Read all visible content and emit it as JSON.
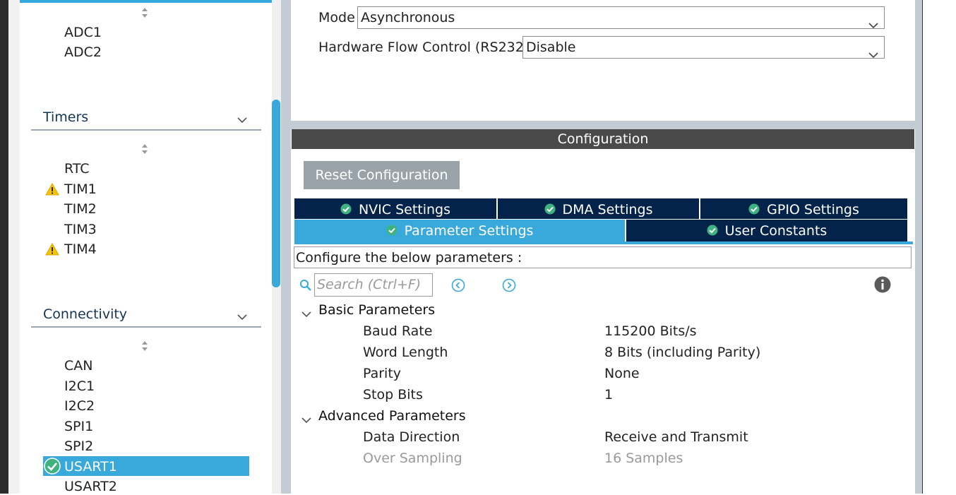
{
  "left_sidebar": {
    "analog_items": [
      "ADC1",
      "ADC2"
    ],
    "timers": {
      "title": "Timers",
      "items": [
        {
          "label": "RTC",
          "warning": false
        },
        {
          "label": "TIM1",
          "warning": true
        },
        {
          "label": "TIM2",
          "warning": false
        },
        {
          "label": "TIM3",
          "warning": false
        },
        {
          "label": "TIM4",
          "warning": true
        }
      ]
    },
    "connectivity": {
      "title": "Connectivity",
      "items": [
        {
          "label": "CAN"
        },
        {
          "label": "I2C1"
        },
        {
          "label": "I2C2"
        },
        {
          "label": "SPI1"
        },
        {
          "label": "SPI2"
        },
        {
          "label": "USART1",
          "selected": true,
          "configured": true
        },
        {
          "label": "USART2"
        }
      ]
    }
  },
  "mode_panel": {
    "mode_label": "Mode",
    "mode_value": "Asynchronous",
    "flow_label": "Hardware Flow Control (RS232)",
    "flow_value": "Disable"
  },
  "configuration": {
    "header": "Configuration",
    "reset_button": "Reset Configuration",
    "tabs_row1": [
      "NVIC Settings",
      "DMA Settings",
      "GPIO Settings"
    ],
    "tabs_row2": [
      "Parameter Settings",
      "User Constants"
    ],
    "active_tab": "Parameter Settings",
    "configure_text": "Configure the below parameters :",
    "search_placeholder": "Search (Ctrl+F)",
    "groups": [
      {
        "title": "Basic Parameters",
        "params": [
          {
            "name": "Baud Rate",
            "value": "115200 Bits/s"
          },
          {
            "name": "Word Length",
            "value": "8 Bits (including Parity)"
          },
          {
            "name": "Parity",
            "value": "None"
          },
          {
            "name": "Stop Bits",
            "value": "1"
          }
        ]
      },
      {
        "title": "Advanced Parameters",
        "params": [
          {
            "name": "Data Direction",
            "value": "Receive and Transmit"
          },
          {
            "name": "Over Sampling",
            "value": "16 Samples",
            "disabled": true
          }
        ]
      }
    ]
  },
  "colors": {
    "accent": "#39a9dc",
    "tab_dark": "#03234b",
    "header_dark": "#4a4a4a",
    "warning": "#f5c400",
    "ok_green": "#3fb37f"
  },
  "icons": {
    "sort": "sort-icon",
    "chevron": "chevron-down-icon",
    "warning": "warning-icon",
    "check": "check-circle-icon",
    "search": "search-icon",
    "prev": "prev-circle-icon",
    "next": "next-circle-icon",
    "info": "info-icon"
  }
}
